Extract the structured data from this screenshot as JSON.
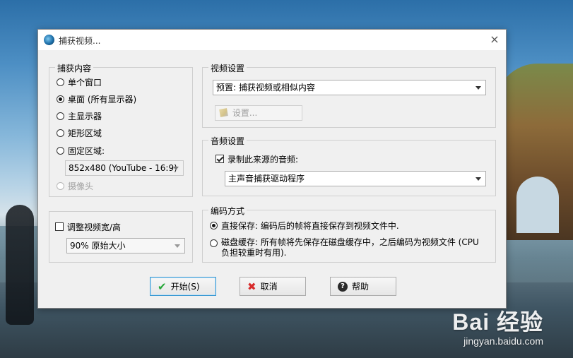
{
  "dialog": {
    "title": "捕获视频...",
    "close_glyph": "×"
  },
  "capture": {
    "group_label": "捕获内容",
    "options": [
      {
        "label": "单个窗口",
        "checked": false
      },
      {
        "label": "桌面 (所有显示器)",
        "checked": true
      },
      {
        "label": "主显示器",
        "checked": false
      },
      {
        "label": "矩形区域",
        "checked": false
      },
      {
        "label": "固定区域:",
        "checked": false
      }
    ],
    "fixed_region_value": "852x480 (YouTube - 16:9)",
    "camera_label": "摄像头"
  },
  "resize": {
    "checkbox_label": "调整视频宽/高",
    "checked": false,
    "size_value": "90% 原始大小"
  },
  "video": {
    "group_label": "视频设置",
    "preset_value": "预置: 捕获视频或相似内容",
    "settings_button": "设置..."
  },
  "audio": {
    "group_label": "音频设置",
    "record_label": "录制此来源的音频:",
    "record_checked": true,
    "source_value": "主声音捕获驱动程序"
  },
  "encoding": {
    "group_label": "编码方式",
    "direct": "直接保存: 编码后的帧将直接保存到视频文件中.",
    "cache": "磁盘缓存: 所有帧将先保存在磁盘缓存中，之后编码为视频文件 (CPU 负担较重时有用)."
  },
  "buttons": {
    "start": "开始(S)",
    "cancel": "取消",
    "help": "帮助"
  },
  "watermark": {
    "logo": "Bai  经验",
    "url": "jingyan.baidu.com"
  }
}
